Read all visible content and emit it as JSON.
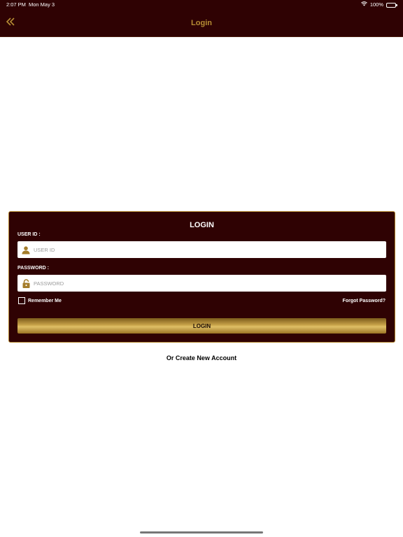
{
  "status_bar": {
    "time": "2:07 PM",
    "date": "Mon May 3",
    "battery": "100%"
  },
  "nav": {
    "title": "Login",
    "back_icon": "double-chevron-left-icon"
  },
  "login_card": {
    "title": "LOGIN",
    "user_id_label": "USER ID :",
    "user_id_placeholder": "USER ID",
    "user_id_value": "",
    "password_label": "PASSWORD :",
    "password_placeholder": "PASSWORD",
    "password_value": "",
    "remember_me_label": "Remember Me",
    "remember_me_checked": false,
    "forgot_password_label": "Forgot Password?",
    "login_button_label": "LOGIN"
  },
  "create_account_label": "Or Create New Account",
  "colors": {
    "brand_dark": "#2f0203",
    "gold": "#b68d34",
    "white": "#ffffff"
  }
}
